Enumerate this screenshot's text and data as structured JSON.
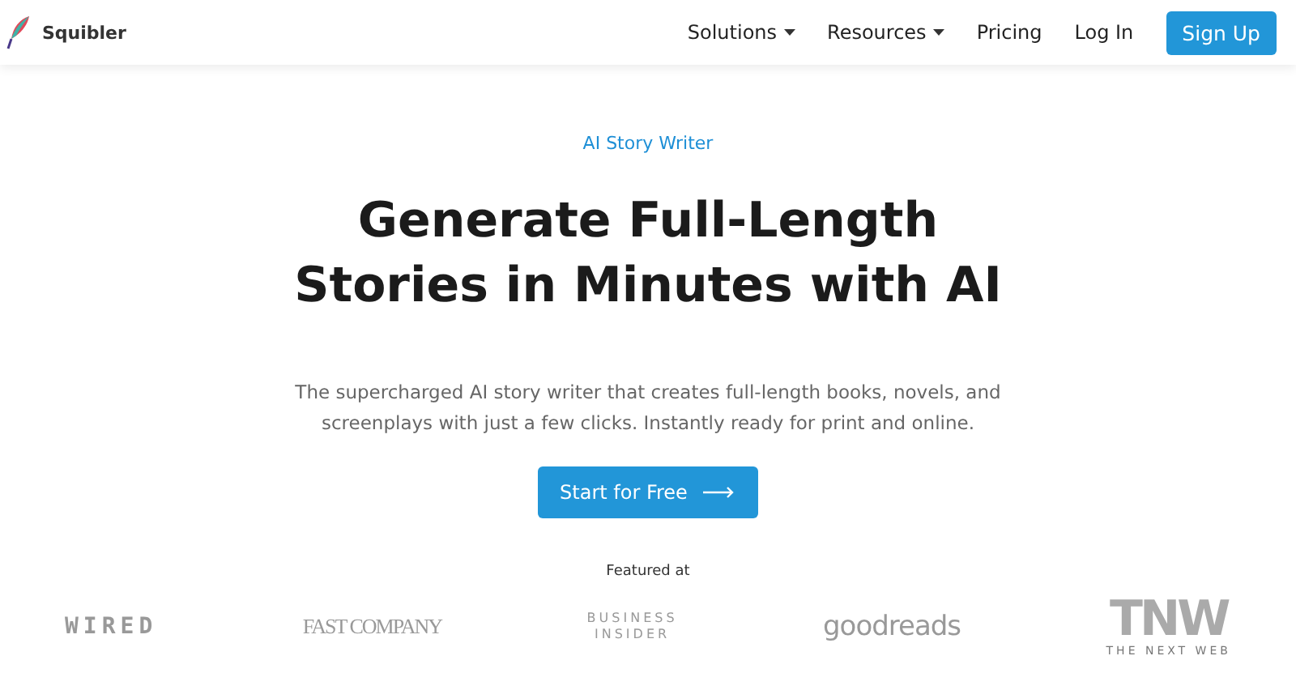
{
  "brand": {
    "name": "Squibler"
  },
  "nav": [
    {
      "label": "Solutions",
      "dropdown": true
    },
    {
      "label": "Resources",
      "dropdown": true
    },
    {
      "label": "Pricing",
      "dropdown": false
    },
    {
      "label": "Log In",
      "dropdown": false
    }
  ],
  "signup": "Sign Up",
  "hero": {
    "eyebrow": "AI Story Writer",
    "title_lines": [
      "Generate Full-Length",
      "Stories in Minutes with AI"
    ],
    "subtitle": "The supercharged AI story writer that creates full-length books, novels, and screenplays with just a few clicks. Instantly ready for print and online.",
    "cta": "Start for Free"
  },
  "featured": {
    "label": "Featured at",
    "logos": [
      {
        "kind": "wired",
        "lines": [
          "WIRED"
        ]
      },
      {
        "kind": "serif",
        "lines": [
          "FAST COMPANY"
        ]
      },
      {
        "kind": "stacked",
        "lines": [
          "BUSINESS",
          "INSIDER"
        ]
      },
      {
        "kind": "light",
        "lines": [
          "goodreads"
        ]
      },
      {
        "kind": "tnw",
        "lines": [
          "TNW",
          "THE NEXT WEB"
        ]
      }
    ]
  }
}
